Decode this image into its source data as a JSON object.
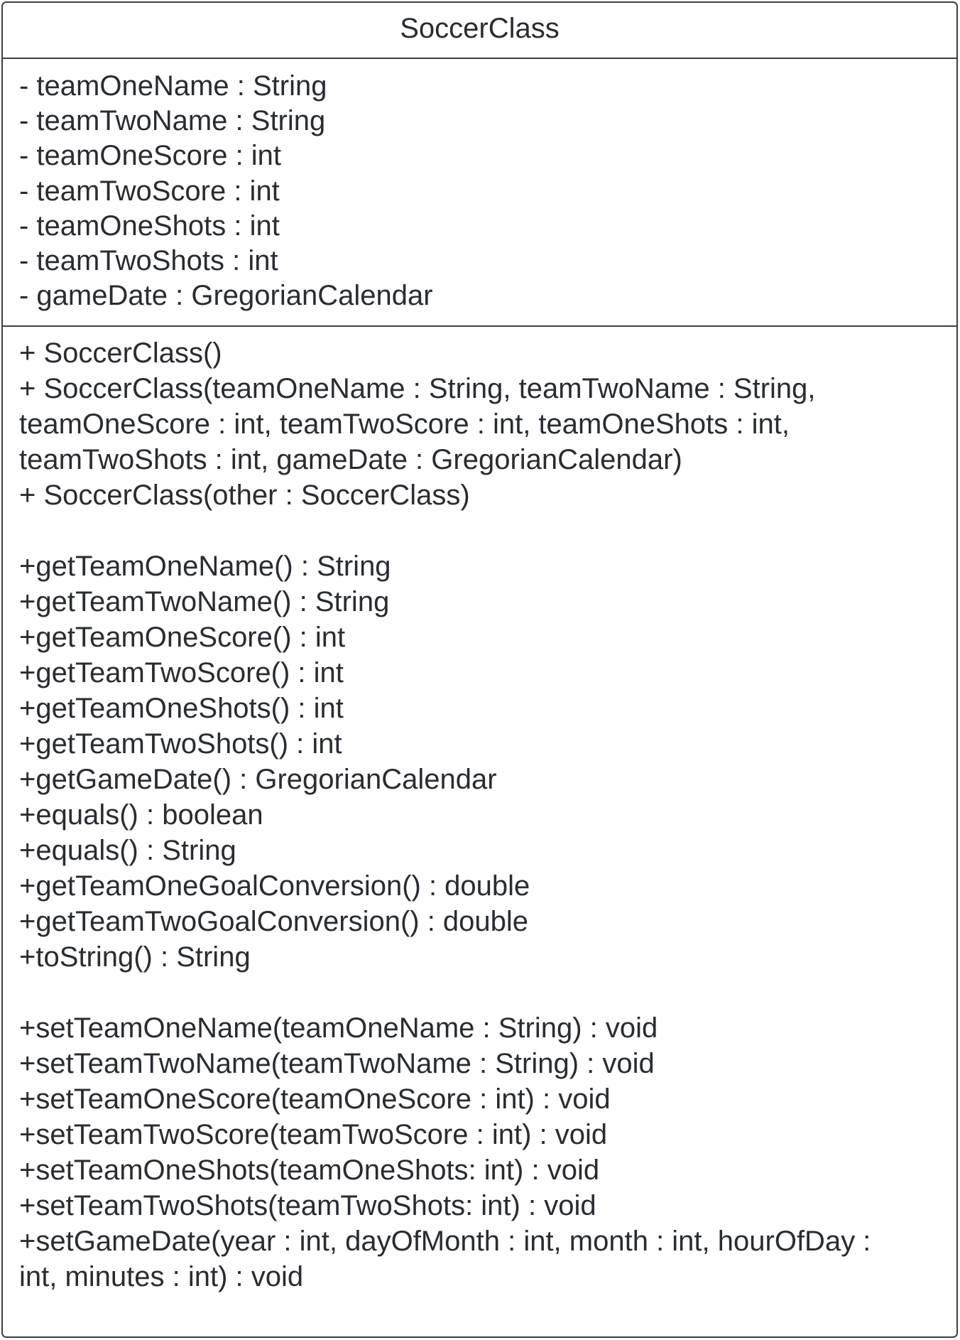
{
  "class_name": "SoccerClass",
  "attributes": [
    "- teamOneName : String",
    "- teamTwoName : String",
    "- teamOneScore : int",
    "- teamTwoScore : int",
    "- teamOneShots : int",
    "- teamTwoShots : int",
    "- gameDate : GregorianCalendar"
  ],
  "operations": [
    "+ SoccerClass()",
    "+ SoccerClass(teamOneName : String, teamTwoName : String,",
    "teamOneScore : int, teamTwoScore : int, teamOneShots : int,",
    "teamTwoShots : int, gameDate : GregorianCalendar)",
    "+ SoccerClass(other : SoccerClass)",
    "",
    "+getTeamOneName() : String",
    "+getTeamTwoName() : String",
    "+getTeamOneScore() : int",
    "+getTeamTwoScore() : int",
    "+getTeamOneShots() : int",
    "+getTeamTwoShots() : int",
    "+getGameDate() : GregorianCalendar",
    "+equals() : boolean",
    "+equals() : String",
    "+getTeamOneGoalConversion() : double",
    "+getTeamTwoGoalConversion() : double",
    "+toString() : String",
    "",
    "+setTeamOneName(teamOneName : String) : void",
    "+setTeamTwoName(teamTwoName : String) : void",
    "+setTeamOneScore(teamOneScore : int) : void",
    "+setTeamTwoScore(teamTwoScore : int) : void",
    "+setTeamOneShots(teamOneShots: int) : void",
    "+setTeamTwoShots(teamTwoShots: int) : void",
    "+setGameDate(year : int, dayOfMonth : int, month : int, hourOfDay :",
    "int, minutes : int) : void"
  ]
}
